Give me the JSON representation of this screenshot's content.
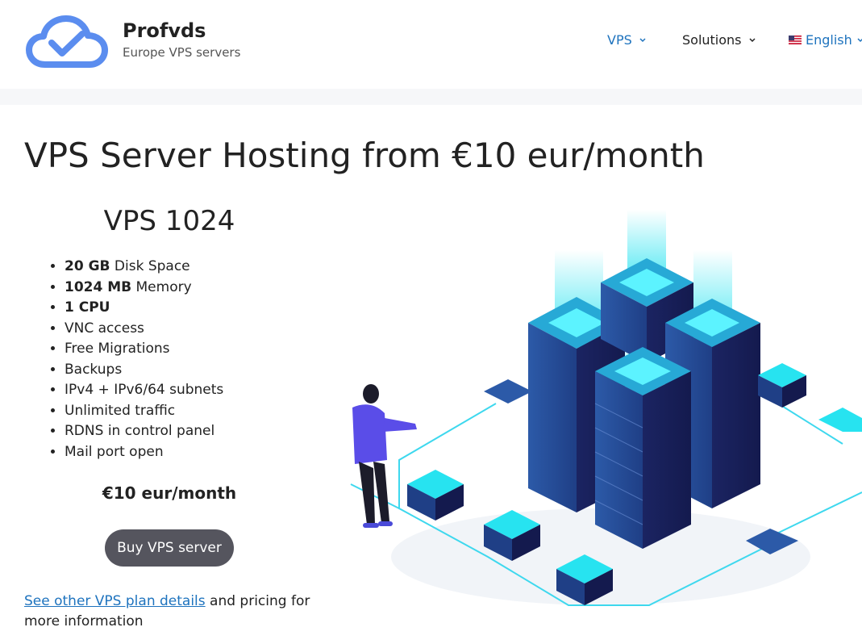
{
  "brand": {
    "name": "Profvds",
    "tagline": "Europe VPS servers"
  },
  "nav": {
    "items": [
      {
        "label": "VPS"
      },
      {
        "label": "Solutions"
      },
      {
        "label": "English"
      }
    ]
  },
  "hero": {
    "title": "VPS Server Hosting from €10 eur/month"
  },
  "plan": {
    "name": "VPS 1024",
    "features": [
      {
        "strong": "20 GB",
        "text": " Disk Space"
      },
      {
        "strong": "1024 MB",
        "text": " Memory"
      },
      {
        "strong": "1 CPU",
        "text": ""
      },
      {
        "strong": "",
        "text": "VNC access"
      },
      {
        "strong": "",
        "text": "Free Migrations"
      },
      {
        "strong": "",
        "text": "Backups"
      },
      {
        "strong": "",
        "text": "IPv4 + IPv6/64 subnets"
      },
      {
        "strong": "",
        "text": "Unlimited traffic"
      },
      {
        "strong": "",
        "text": "RDNS in control panel"
      },
      {
        "strong": "",
        "text": "Mail port open"
      }
    ],
    "price": "€10 eur/month",
    "buy_label": "Buy VPS server"
  },
  "footer_note": {
    "link_text": "See other VPS plan details",
    "rest_text": " and pricing for more information"
  },
  "icons": {
    "logo": "cloud-check-icon",
    "chevron": "chevron-down-icon",
    "flag": "us-flag-icon"
  },
  "colors": {
    "accent": "#1e73be",
    "logo_blue": "#5b8def",
    "button": "#55555e",
    "server_dark": "#1f2a6b",
    "glow": "#27e3f0"
  }
}
